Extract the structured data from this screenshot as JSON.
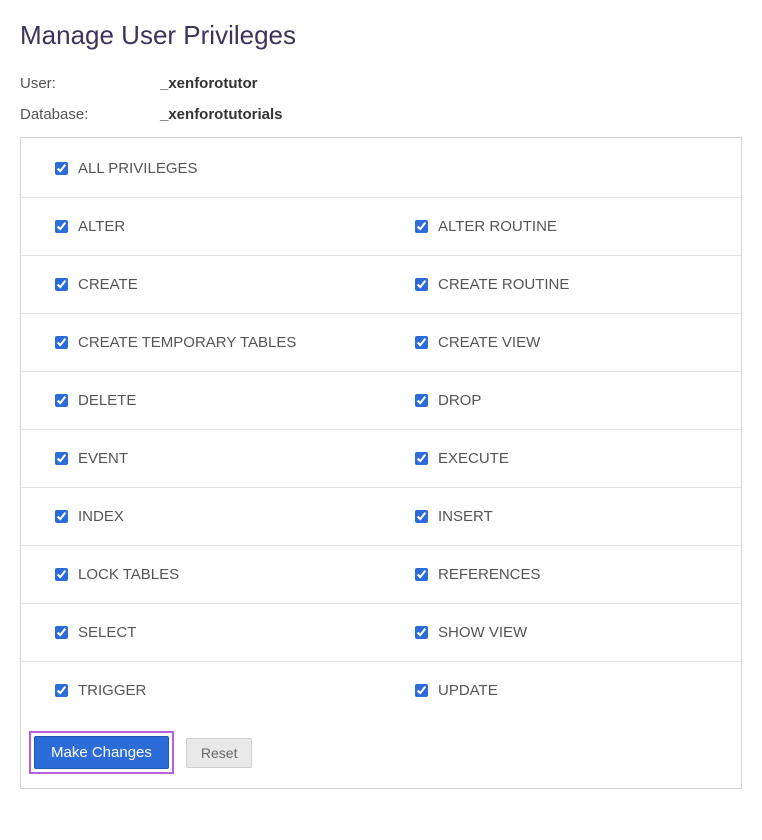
{
  "page": {
    "title": "Manage User Privileges"
  },
  "info": {
    "user_label": "User:",
    "user_value": "_xenforotutor",
    "database_label": "Database:",
    "database_value": "_xenforotutorials"
  },
  "all_privileges": {
    "label": "ALL PRIVILEGES",
    "checked": true
  },
  "privileges": [
    {
      "left": {
        "label": "ALTER",
        "checked": true
      },
      "right": {
        "label": "ALTER ROUTINE",
        "checked": true
      }
    },
    {
      "left": {
        "label": "CREATE",
        "checked": true
      },
      "right": {
        "label": "CREATE ROUTINE",
        "checked": true
      }
    },
    {
      "left": {
        "label": "CREATE TEMPORARY TABLES",
        "checked": true
      },
      "right": {
        "label": "CREATE VIEW",
        "checked": true
      }
    },
    {
      "left": {
        "label": "DELETE",
        "checked": true
      },
      "right": {
        "label": "DROP",
        "checked": true
      }
    },
    {
      "left": {
        "label": "EVENT",
        "checked": true
      },
      "right": {
        "label": "EXECUTE",
        "checked": true
      }
    },
    {
      "left": {
        "label": "INDEX",
        "checked": true
      },
      "right": {
        "label": "INSERT",
        "checked": true
      }
    },
    {
      "left": {
        "label": "LOCK TABLES",
        "checked": true
      },
      "right": {
        "label": "REFERENCES",
        "checked": true
      }
    },
    {
      "left": {
        "label": "SELECT",
        "checked": true
      },
      "right": {
        "label": "SHOW VIEW",
        "checked": true
      }
    },
    {
      "left": {
        "label": "TRIGGER",
        "checked": true
      },
      "right": {
        "label": "UPDATE",
        "checked": true
      }
    }
  ],
  "actions": {
    "submit_label": "Make Changes",
    "reset_label": "Reset"
  }
}
